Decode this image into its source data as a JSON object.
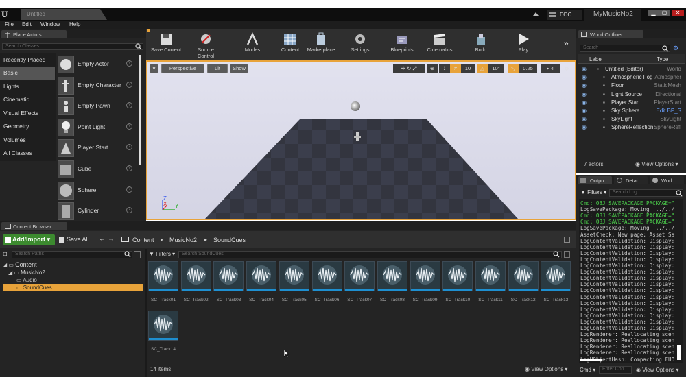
{
  "window": {
    "tab_title": "Untitled",
    "ddc": "DDC",
    "project": "MyMusicNo2",
    "min": "▁",
    "max": "▢",
    "close": "✕"
  },
  "menu": [
    "File",
    "Edit",
    "Window",
    "Help"
  ],
  "place_actors": {
    "tab": "Place Actors",
    "search_placeholder": "Search Classes",
    "categories": [
      "Recently Placed",
      "Basic",
      "Lights",
      "Cinematic",
      "Visual Effects",
      "Geometry",
      "Volumes",
      "All Classes"
    ],
    "selected_category": "Basic",
    "actors": [
      "Empty Actor",
      "Empty Character",
      "Empty Pawn",
      "Point Light",
      "Player Start",
      "Cube",
      "Sphere",
      "Cylinder"
    ]
  },
  "toolbar": [
    "Save Current",
    "Source Control",
    "Modes",
    "Content",
    "Marketplace",
    "Settings",
    "Blueprints",
    "Cinematics",
    "Build",
    "Play"
  ],
  "viewport": {
    "perspective": "Perspective",
    "lit": "Lit",
    "show": "Show",
    "grid_snap": "10",
    "rot_snap": "10°",
    "scale_snap": "0.25",
    "cam_speed": "4",
    "axis_labels": {
      "z": "Z",
      "x": "X",
      "y": "Y"
    }
  },
  "content_browser": {
    "tab": "Content Browser",
    "add_import": "Add/Import",
    "save_all": "Save All",
    "breadcrumb": [
      "Content",
      "MusicNo2",
      "SoundCues"
    ],
    "search_paths": "Search Paths",
    "tree": [
      "Content",
      "MusicNo2",
      "Audio",
      "SoundCues"
    ],
    "filters": "Filters",
    "search_assets": "Search SoundCues",
    "assets": [
      "SC_Track01",
      "SC_Track02",
      "SC_Track03",
      "SC_Track04",
      "SC_Track05",
      "SC_Track06",
      "SC_Track07",
      "SC_Track08",
      "SC_Track09",
      "SC_Track10",
      "SC_Track11",
      "SC_Track12",
      "SC_Track13",
      "SC_Track14"
    ],
    "item_count": "14 items",
    "view_options": "View Options"
  },
  "world_outliner": {
    "tab": "World Outliner",
    "search": "Search",
    "col_label": "Label",
    "col_type": "Type",
    "rows": [
      {
        "label": "Untitled (Editor)",
        "type": "World"
      },
      {
        "label": "Atmospheric Fog",
        "type": "Atmospher"
      },
      {
        "label": "Floor",
        "type": "StaticMesh"
      },
      {
        "label": "Light Source",
        "type": "Directional"
      },
      {
        "label": "Player Start",
        "type": "PlayerStart"
      },
      {
        "label": "Sky Sphere",
        "type": "Edit BP_S"
      },
      {
        "label": "SkyLight",
        "type": "SkyLight"
      },
      {
        "label": "SphereReflection",
        "type": "SphereRefl"
      }
    ],
    "actor_count": "7 actors",
    "view_options": "View Options"
  },
  "output_log": {
    "tabs": [
      "Outpu",
      "Detai",
      "Worl"
    ],
    "filters": "Filters",
    "search": "Search Log",
    "lines": [
      {
        "t": "Cmd: OBJ SAVEPACKAGE PACKAGE=\"",
        "c": "green"
      },
      {
        "t": "LogSavePackage: Moving '../../",
        "c": ""
      },
      {
        "t": "Cmd: OBJ SAVEPACKAGE PACKAGE=\"",
        "c": "green"
      },
      {
        "t": "Cmd: OBJ SAVEPACKAGE PACKAGE=\"",
        "c": "green"
      },
      {
        "t": "LogSavePackage: Moving '../../",
        "c": ""
      },
      {
        "t": "AssetCheck: New page: Asset Sa",
        "c": ""
      },
      {
        "t": "LogContentValidation: Display:",
        "c": ""
      },
      {
        "t": "LogContentValidation: Display:",
        "c": ""
      },
      {
        "t": "LogContentValidation: Display:",
        "c": ""
      },
      {
        "t": "LogContentValidation: Display:",
        "c": ""
      },
      {
        "t": "LogContentValidation: Display:",
        "c": ""
      },
      {
        "t": "LogContentValidation: Display:",
        "c": ""
      },
      {
        "t": "LogContentValidation: Display:",
        "c": ""
      },
      {
        "t": "LogContentValidation: Display:",
        "c": ""
      },
      {
        "t": "LogContentValidation: Display:",
        "c": ""
      },
      {
        "t": "LogContentValidation: Display:",
        "c": ""
      },
      {
        "t": "LogContentValidation: Display:",
        "c": ""
      },
      {
        "t": "LogContentValidation: Display:",
        "c": ""
      },
      {
        "t": "LogContentValidation: Display:",
        "c": ""
      },
      {
        "t": "LogContentValidation: Display:",
        "c": ""
      },
      {
        "t": "LogContentValidation: Display:",
        "c": ""
      },
      {
        "t": "LogRenderer: Reallocating scen",
        "c": ""
      },
      {
        "t": "LogRenderer: Reallocating scen",
        "c": ""
      },
      {
        "t": "LogRenderer: Reallocating scen",
        "c": ""
      },
      {
        "t": "LogRenderer: Reallocating scen",
        "c": ""
      },
      {
        "t": "LogUObjectHash: Compacting FUO",
        "c": ""
      }
    ],
    "cmd": "Cmd",
    "cmd_placeholder": "Enter Con",
    "view_options": "View Options"
  }
}
